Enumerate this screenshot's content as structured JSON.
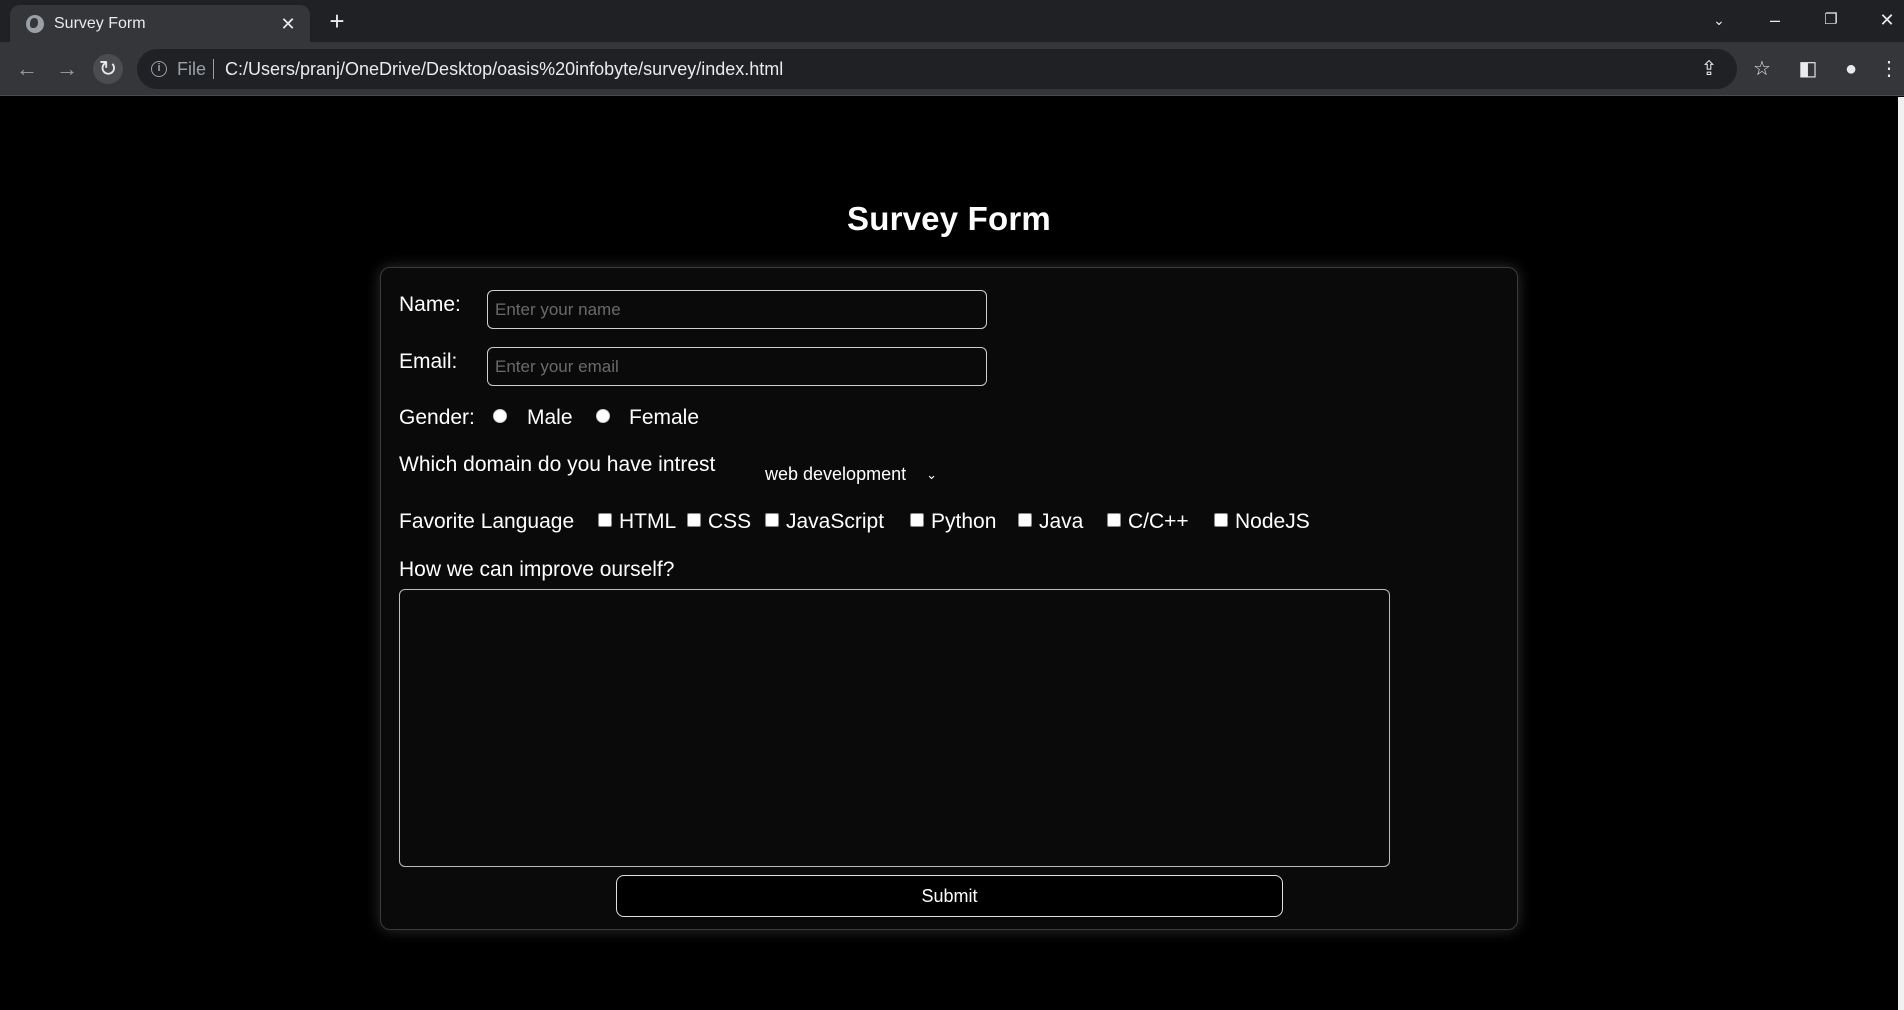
{
  "browser": {
    "tab_title": "Survey Form",
    "file_label": "File",
    "url": "C:/Users/pranj/OneDrive/Desktop/oasis%20infobyte/survey/index.html"
  },
  "form": {
    "title": "Survey Form",
    "name_label": "Name:",
    "name_placeholder": "Enter your name",
    "email_label": "Email:",
    "email_placeholder": "Enter your email",
    "gender_label": "Gender:",
    "gender_options": [
      "Male",
      "Female"
    ],
    "domain_label": "Which domain do you have intrest",
    "domain_selected": "web development",
    "language_label": "Favorite Language",
    "languages": [
      "HTML",
      "CSS",
      "JavaScript",
      "Python",
      "Java",
      "C/C++",
      "NodeJS"
    ],
    "improve_label": "How we can improve ourself?",
    "submit_label": "Submit"
  }
}
